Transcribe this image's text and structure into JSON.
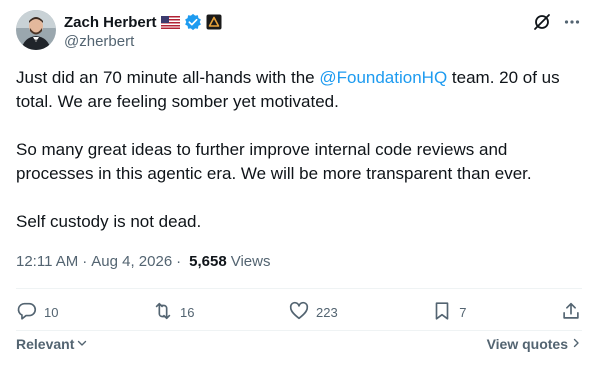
{
  "author": {
    "display_name": "Zach Herbert",
    "handle": "@zherbert"
  },
  "icons": {
    "flag": "us-flag-icon",
    "verified": "verified-badge-icon",
    "affiliate": "affiliate-logo-icon",
    "grok": "grok-icon",
    "more": "more-icon"
  },
  "post": {
    "line1_before": "Just did an 70 minute all-hands with the ",
    "mention": "@FoundationHQ",
    "line1_after": " team. 20 of us total. We are feeling somber yet motivated.",
    "paragraph2": "So many great ideas to further improve internal code reviews and processes in this agentic era. We will be more transparent than ever.",
    "paragraph3": "Self custody is not dead."
  },
  "meta": {
    "time": "12:11 AM",
    "date": "Aug 4, 2026",
    "separator": "·",
    "views_count": "5,658",
    "views_label": "Views"
  },
  "actions": {
    "replies": "10",
    "reposts": "16",
    "likes": "223",
    "bookmarks": "7"
  },
  "footer": {
    "sort_label": "Relevant",
    "quotes_label": "View quotes"
  },
  "colors": {
    "accent": "#1d9bf0",
    "text": "#0f1419",
    "secondary": "#536471",
    "divider": "#eff3f4"
  }
}
